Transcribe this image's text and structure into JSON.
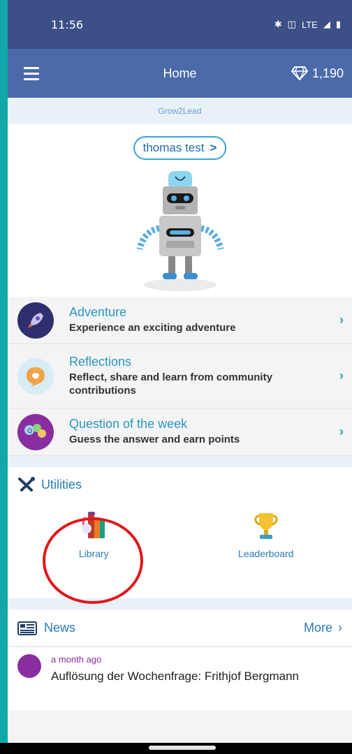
{
  "status_bar": {
    "time": "11:56",
    "network": "LTE"
  },
  "app_bar": {
    "title": "Home",
    "gems": "1,190"
  },
  "brand": "Grow2Lead",
  "profile": {
    "user_name": "thomas test",
    "chevron": ">"
  },
  "features": [
    {
      "title": "Adventure",
      "subtitle": "Experience an exciting adventure",
      "icon": "rocket-icon",
      "color": "#2f2e6e"
    },
    {
      "title": "Reflections",
      "subtitle": "Reflect, share and learn from community contributions",
      "icon": "reflection-bubble-icon",
      "color": "#d8ecf6"
    },
    {
      "title": "Question of the week",
      "subtitle": "Guess the answer and earn points",
      "icon": "qotw-icon",
      "color": "#8a2da0"
    }
  ],
  "utilities": {
    "title": "Utilities",
    "items": [
      {
        "label": "Library",
        "icon": "library-books-icon"
      },
      {
        "label": "Leaderboard",
        "icon": "trophy-icon"
      }
    ]
  },
  "news": {
    "title": "News",
    "more": "More",
    "items": [
      {
        "time": "a month ago",
        "text": "Auflösung der Wochenfrage: Frithjof Bergmann"
      }
    ]
  },
  "colors": {
    "accent": "#2a96c5",
    "app_bar": "#4a6aaa",
    "status_bar": "#3c4f86",
    "highlight": "#e0181b"
  }
}
